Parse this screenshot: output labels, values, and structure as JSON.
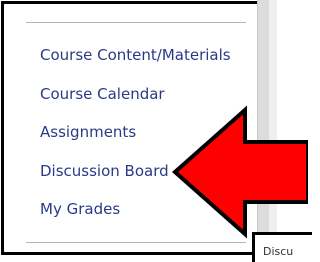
{
  "menu": {
    "items": [
      {
        "label": "Course Content/Materials"
      },
      {
        "label": "Course Calendar"
      },
      {
        "label": "Assignments"
      },
      {
        "label": "Discussion Board"
      },
      {
        "label": "My Grades"
      }
    ]
  },
  "tooltip": {
    "text": "Discu"
  },
  "colors": {
    "link": "#2a3a86",
    "arrow_fill": "#ff0000",
    "arrow_stroke": "#000000",
    "border": "#000000"
  },
  "icons": {
    "arrow": "left-arrow-icon"
  }
}
